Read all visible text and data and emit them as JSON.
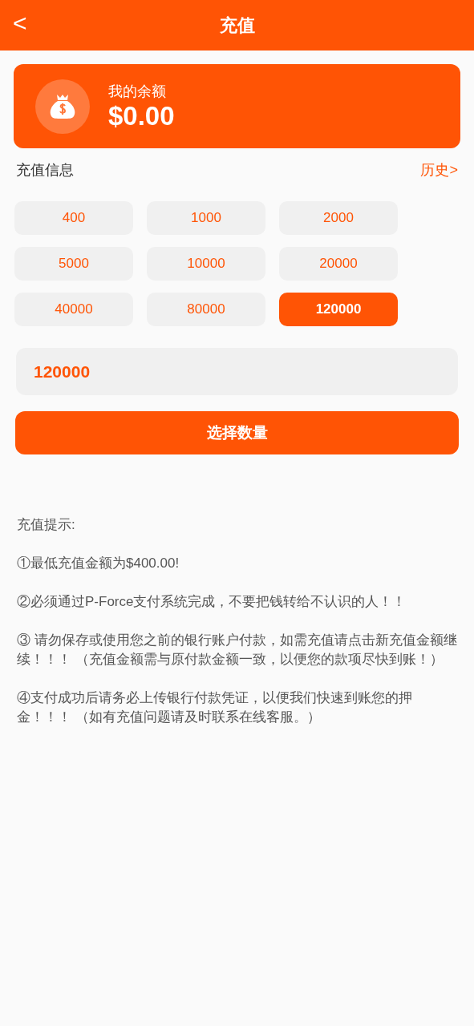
{
  "header": {
    "back": "<",
    "title": "充值"
  },
  "balance": {
    "label": "我的余额",
    "amount": "$0.00"
  },
  "section": {
    "title": "充值信息",
    "link": "历史>"
  },
  "amounts": [
    {
      "label": "400",
      "selected": false
    },
    {
      "label": "1000",
      "selected": false
    },
    {
      "label": "2000",
      "selected": false
    },
    {
      "label": "5000",
      "selected": false
    },
    {
      "label": "10000",
      "selected": false
    },
    {
      "label": "20000",
      "selected": false
    },
    {
      "label": "40000",
      "selected": false
    },
    {
      "label": "80000",
      "selected": false
    },
    {
      "label": "120000",
      "selected": true
    }
  ],
  "amount_field": {
    "value": "120000"
  },
  "submit": "选择数量",
  "tips": [
    "充值提示:",
    "①最低充值金额为$400.00!",
    "②必须通过P-Force支付系统完成，不要把钱转给不认识的人！！",
    "③ 请勿保存或使用您之前的银行账户付款，如需充值请点击新充值金额继续！！！ （充值金额需与原付款金额一致，以便您的款项尽快到账！）",
    "④支付成功后请务必上传银行付款凭证，以便我们快速到账您的押金！！！ （如有充值问题请及时联系在线客服。）"
  ]
}
